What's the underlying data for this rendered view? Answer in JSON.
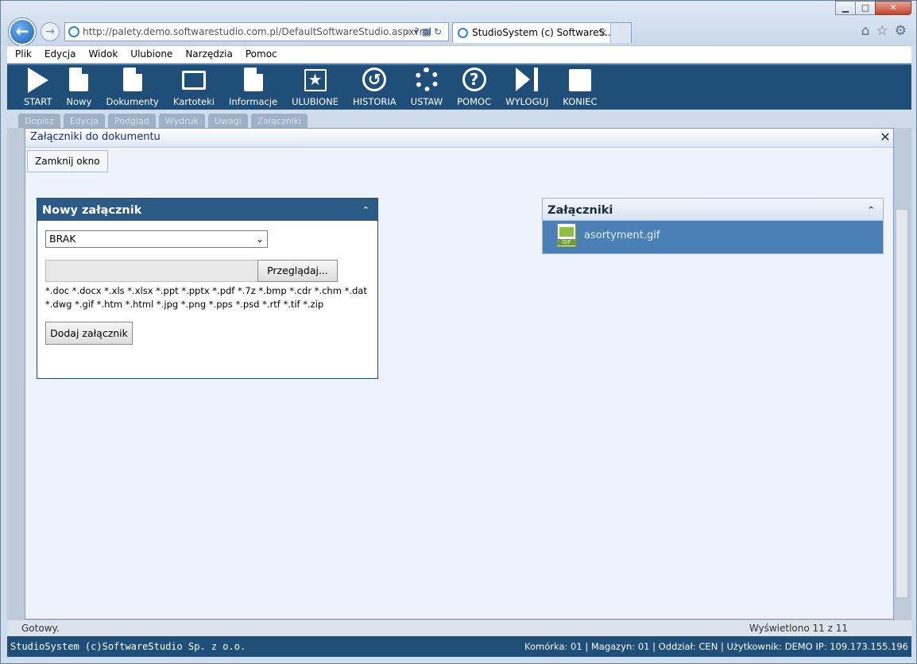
{
  "browser": {
    "address": "http://palety.demo.softwarestudio.com.pl/DefaultSoftwareStudio.aspx?rol",
    "tab_title": "StudioSystem (c) SoftwareS...",
    "tab_close": "×"
  },
  "menu": [
    {
      "label": "Plik"
    },
    {
      "label": "Edycja"
    },
    {
      "label": "Widok"
    },
    {
      "label": "Ulubione"
    },
    {
      "label": "Narzędzia"
    },
    {
      "label": "Pomoc"
    }
  ],
  "toolbar": [
    {
      "label": "START",
      "icon": "play-icon"
    },
    {
      "label": "Nowy",
      "icon": "new-document-icon"
    },
    {
      "label": "Dokumenty",
      "icon": "documents-icon"
    },
    {
      "label": "Kartoteki",
      "icon": "card-index-icon"
    },
    {
      "label": "Informacje",
      "icon": "info-icon"
    },
    {
      "label": "ULUBIONE",
      "icon": "star-icon"
    },
    {
      "label": "HISTORIA",
      "icon": "history-icon"
    },
    {
      "label": "USTAW",
      "icon": "gear-icon"
    },
    {
      "label": "POMOC",
      "icon": "question-icon"
    },
    {
      "label": "WYLOGUJ",
      "icon": "logout-icon"
    },
    {
      "label": "KONIEC",
      "icon": "exit-icon"
    }
  ],
  "subtoolbar": [
    "Dopisz",
    "Edycja",
    "Podgląd",
    "Wydruk",
    "Uwagi",
    "Załączniki"
  ],
  "background_status": {
    "left": "Gotowy.",
    "right": "Wyświetlono 11 z 11"
  },
  "dialog": {
    "title": "Załączniki do dokumentu",
    "close_glyph": "✕",
    "close_button": "Zamknij okno",
    "new_panel": {
      "title": "Nowy załącznik",
      "collapse_glyph": "⌃",
      "select_value": "BRAK",
      "browse_button": "Przeglądaj...",
      "extensions": "*.doc *.docx *.xls *.xlsx *.ppt *.pptx *.pdf *.7z *.bmp *.cdr *.chm *.dat *.dwg *.gif *.htm *.html *.jpg *.png *.pps *.psd *.rtf *.tif *.zip",
      "add_button": "Dodaj załącznik"
    },
    "attachments_panel": {
      "title": "Załączniki",
      "collapse_glyph": "⌃",
      "items": [
        {
          "name": "asortyment.gif",
          "badge": "GIF"
        }
      ]
    }
  },
  "app_status": {
    "left": "StudioSystem (c)SoftwareStudio Sp. z o.o.",
    "right": "Komórka: 01 | Magazyn: 01 | Oddział: CEN | Użytkownik: DEMO IP: 109.173.155.196"
  },
  "colors": {
    "brand_dark": "#1f4e78",
    "selection": "#4a80b5"
  }
}
